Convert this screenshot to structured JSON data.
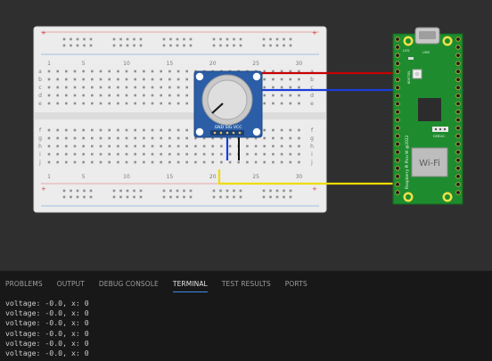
{
  "breadboard": {
    "col_numbers": [
      "1",
      "5",
      "10",
      "15",
      "20",
      "25",
      "30"
    ],
    "row_letters_top": [
      "a",
      "b",
      "c",
      "d",
      "e"
    ],
    "row_letters_bottom": [
      "f",
      "g",
      "h",
      "i",
      "j"
    ]
  },
  "potentiometer": {
    "pin_label": "GND SIG VCC"
  },
  "pico": {
    "board_label": "Raspberry Pi Pico W @2022",
    "wifi_label": "Wi-Fi",
    "led_label": "LED",
    "usb_label": "USB",
    "bootsel_label": "BOOTSEL",
    "debug_label": "DEBUG"
  },
  "wires": {
    "red": "#c50000",
    "blue": "#1a3fd8",
    "yellow": "#f0dc00",
    "black": "#111111"
  },
  "panel": {
    "tabs": [
      "PROBLEMS",
      "OUTPUT",
      "DEBUG CONSOLE",
      "TERMINAL",
      "TEST RESULTS",
      "PORTS"
    ],
    "active_tab": "TERMINAL",
    "terminal_lines": [
      "voltage: -0.0, x: 0",
      "voltage: -0.0, x: 0",
      "voltage: -0.0, x: 0",
      "voltage: -0.0, x: 0",
      "voltage: -0.0, x: 0",
      "voltage: -0.0, x: 0"
    ]
  }
}
